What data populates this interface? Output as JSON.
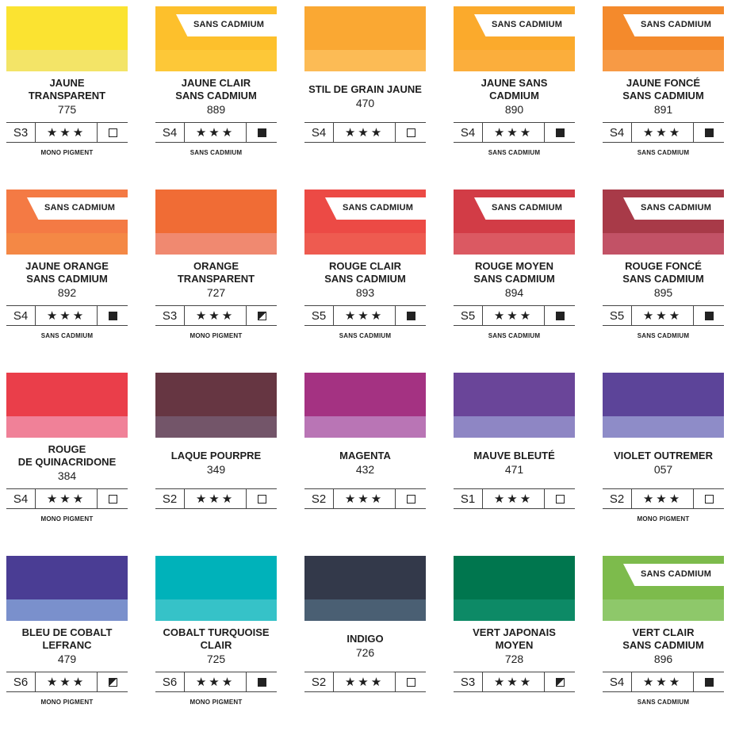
{
  "banner_label": "SANS CADMIUM",
  "swatches": [
    {
      "name_lines": [
        "JAUNE",
        "TRANSPARENT"
      ],
      "code": "775",
      "series": "S3",
      "stars": "★★★",
      "opacity": "transparent",
      "note": "MONO PIGMENT",
      "banner": false,
      "color": "#FBE331",
      "color_light": "#F3E467"
    },
    {
      "name_lines": [
        "JAUNE CLAIR",
        "SANS CADMIUM"
      ],
      "code": "889",
      "series": "S4",
      "stars": "★★★",
      "opacity": "opaque",
      "note": "SANS CADMIUM",
      "banner": true,
      "color": "#FDC02C",
      "color_light": "#FDC838"
    },
    {
      "name_lines": [
        "STIL DE GRAIN JAUNE"
      ],
      "code": "470",
      "series": "S4",
      "stars": "★★★",
      "opacity": "transparent",
      "note": "",
      "banner": false,
      "color": "#FAA833",
      "color_light": "#FCBB55"
    },
    {
      "name_lines": [
        "JAUNE SANS",
        "CADMIUM"
      ],
      "code": "890",
      "series": "S4",
      "stars": "★★★",
      "opacity": "opaque",
      "note": "SANS CADMIUM",
      "banner": true,
      "color": "#FBAA2C",
      "color_light": "#FBAE3C"
    },
    {
      "name_lines": [
        "JAUNE FONCÉ",
        "SANS CADMIUM"
      ],
      "code": "891",
      "series": "S4",
      "stars": "★★★",
      "opacity": "opaque",
      "note": "SANS CADMIUM",
      "banner": true,
      "color": "#F48A2C",
      "color_light": "#F79A45"
    },
    {
      "name_lines": [
        "JAUNE ORANGE",
        "SANS CADMIUM"
      ],
      "code": "892",
      "series": "S4",
      "stars": "★★★",
      "opacity": "opaque",
      "note": "SANS CADMIUM",
      "banner": true,
      "color": "#F47A44",
      "color_light": "#F48845"
    },
    {
      "name_lines": [
        "ORANGE",
        "TRANSPARENT"
      ],
      "code": "727",
      "series": "S3",
      "stars": "★★★",
      "opacity": "semi",
      "note": "MONO PIGMENT",
      "banner": false,
      "color": "#F06C35",
      "color_light": "#F08970"
    },
    {
      "name_lines": [
        "ROUGE CLAIR",
        "SANS CADMIUM"
      ],
      "code": "893",
      "series": "S5",
      "stars": "★★★",
      "opacity": "opaque",
      "note": "SANS CADMIUM",
      "banner": true,
      "color": "#EC4A45",
      "color_light": "#EE5B50"
    },
    {
      "name_lines": [
        "ROUGE MOYEN",
        "SANS CADMIUM"
      ],
      "code": "894",
      "series": "S5",
      "stars": "★★★",
      "opacity": "opaque",
      "note": "SANS CADMIUM",
      "banner": true,
      "color": "#D23C46",
      "color_light": "#DB5962"
    },
    {
      "name_lines": [
        "ROUGE FONCÉ",
        "SANS CADMIUM"
      ],
      "code": "895",
      "series": "S5",
      "stars": "★★★",
      "opacity": "opaque",
      "note": "SANS CADMIUM",
      "banner": true,
      "color": "#A83A48",
      "color_light": "#C25266"
    },
    {
      "name_lines": [
        "ROUGE",
        "DE QUINACRIDONE"
      ],
      "code": "384",
      "series": "S4",
      "stars": "★★★",
      "opacity": "transparent",
      "note": "MONO PIGMENT",
      "banner": false,
      "color": "#EA3E4A",
      "color_light": "#F08198"
    },
    {
      "name_lines": [
        "LAQUE POURPRE"
      ],
      "code": "349",
      "series": "S2",
      "stars": "★★★",
      "opacity": "transparent",
      "note": "",
      "banner": false,
      "color": "#663642",
      "color_light": "#735569"
    },
    {
      "name_lines": [
        "MAGENTA"
      ],
      "code": "432",
      "series": "S2",
      "stars": "★★★",
      "opacity": "transparent",
      "note": "",
      "banner": false,
      "color": "#A43282",
      "color_light": "#B975B5"
    },
    {
      "name_lines": [
        "MAUVE BLEUTÉ"
      ],
      "code": "471",
      "series": "S1",
      "stars": "★★★",
      "opacity": "transparent",
      "note": "",
      "banner": false,
      "color": "#6A4599",
      "color_light": "#8E86C4"
    },
    {
      "name_lines": [
        "VIOLET OUTREMER"
      ],
      "code": "057",
      "series": "S2",
      "stars": "★★★",
      "opacity": "transparent",
      "note": "MONO PIGMENT",
      "banner": false,
      "color": "#5C4499",
      "color_light": "#8E8CC8"
    },
    {
      "name_lines": [
        "BLEU DE COBALT",
        "LEFRANC"
      ],
      "code": "479",
      "series": "S6",
      "stars": "★★★",
      "opacity": "semi",
      "note": "MONO PIGMENT",
      "banner": false,
      "color": "#4A3D94",
      "color_light": "#7A90CC"
    },
    {
      "name_lines": [
        "COBALT TURQUOISE",
        "CLAIR"
      ],
      "code": "725",
      "series": "S6",
      "stars": "★★★",
      "opacity": "opaque",
      "note": "MONO PIGMENT",
      "banner": false,
      "color": "#00B2BA",
      "color_light": "#36C2C8"
    },
    {
      "name_lines": [
        "INDIGO"
      ],
      "code": "726",
      "series": "S2",
      "stars": "★★★",
      "opacity": "transparent",
      "note": "",
      "banner": false,
      "color": "#33394A",
      "color_light": "#4A5F73"
    },
    {
      "name_lines": [
        "VERT JAPONAIS",
        "MOYEN"
      ],
      "code": "728",
      "series": "S3",
      "stars": "★★★",
      "opacity": "semi",
      "note": "",
      "banner": false,
      "color": "#00764E",
      "color_light": "#0D8A66"
    },
    {
      "name_lines": [
        "VERT CLAIR",
        "SANS CADMIUM"
      ],
      "code": "896",
      "series": "S4",
      "stars": "★★★",
      "opacity": "opaque",
      "note": "SANS CADMIUM",
      "banner": true,
      "color": "#7DBB4C",
      "color_light": "#8EC86A"
    }
  ]
}
